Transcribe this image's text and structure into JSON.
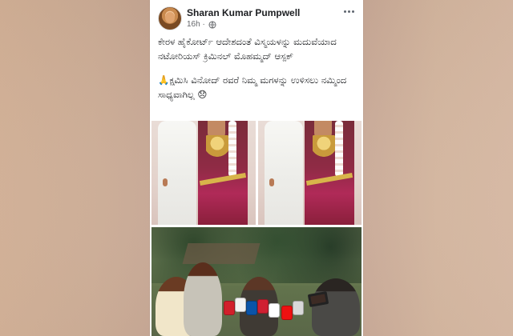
{
  "post": {
    "author": "Sharan Kumar Pumpwell",
    "time": "16h ·",
    "paragraph_1": "ಕೇರಳ ಹೈಕೋರ್ಟ್ ಆದೇಶದಂತೆ ವಿಸ್ಮಯಳನ್ನು ಮದುವೆಯಾದ ನಟೋರಿಯಸ್ ಕ್ರಿಮಿನಲ್ ಮೊಹಮ್ಮದ್ ಆಸ್ಪಕ್",
    "paragraph_2": "🙏ಕ್ಷಮಿಸಿ ವಿನೋದ್ ರವರೆ ನಿಮ್ಮ ಮಗಳನ್ನು ಉಳಿಸಲು ನಮ್ಮಿಂದ ಸಾಧ್ಯವಾಗಿಲ್ಲ 😞"
  },
  "icons": {
    "privacy": "globe-icon",
    "menu": "more-options-icon"
  },
  "colors": {
    "background_left": "#d8b59a",
    "background_right": "#ddbea8",
    "card": "#ffffff",
    "author_text": "#1c1e21",
    "meta_text": "#65676b"
  }
}
